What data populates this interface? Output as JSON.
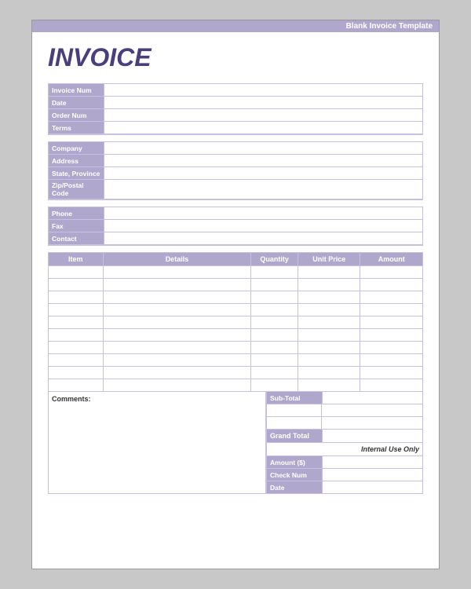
{
  "banner": {
    "text": "Blank Invoice Template"
  },
  "title": "INVOICE",
  "fields": {
    "invoice_num_label": "Invoice Num",
    "date_label": "Date",
    "order_num_label": "Order Num",
    "terms_label": "Terms",
    "company_label": "Company",
    "address_label": "Address",
    "state_province_label": "State, Province",
    "zip_postal_label": "Zip/Postal Code",
    "phone_label": "Phone",
    "fax_label": "Fax",
    "contact_label": "Contact"
  },
  "table": {
    "headers": {
      "item": "Item",
      "details": "Details",
      "quantity": "Quantity",
      "unit_price": "Unit Price",
      "amount": "Amount"
    },
    "rows": 10
  },
  "comments_label": "Comments:",
  "totals": {
    "sub_total_label": "Sub-Total",
    "grand_total_label": "Grand Total",
    "amount_label": "Amount ($)",
    "check_num_label": "Check Num",
    "date_label": "Date"
  },
  "internal_use": "Internal Use Only"
}
